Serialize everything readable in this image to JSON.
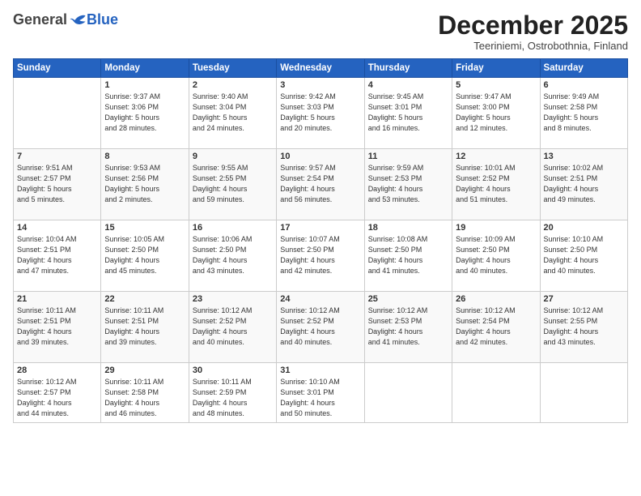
{
  "header": {
    "logo_general": "General",
    "logo_blue": "Blue",
    "month_title": "December 2025",
    "location": "Teeriniemi, Ostrobothnia, Finland"
  },
  "weekdays": [
    "Sunday",
    "Monday",
    "Tuesday",
    "Wednesday",
    "Thursday",
    "Friday",
    "Saturday"
  ],
  "weeks": [
    [
      {
        "day": "",
        "info": ""
      },
      {
        "day": "1",
        "info": "Sunrise: 9:37 AM\nSunset: 3:06 PM\nDaylight: 5 hours\nand 28 minutes."
      },
      {
        "day": "2",
        "info": "Sunrise: 9:40 AM\nSunset: 3:04 PM\nDaylight: 5 hours\nand 24 minutes."
      },
      {
        "day": "3",
        "info": "Sunrise: 9:42 AM\nSunset: 3:03 PM\nDaylight: 5 hours\nand 20 minutes."
      },
      {
        "day": "4",
        "info": "Sunrise: 9:45 AM\nSunset: 3:01 PM\nDaylight: 5 hours\nand 16 minutes."
      },
      {
        "day": "5",
        "info": "Sunrise: 9:47 AM\nSunset: 3:00 PM\nDaylight: 5 hours\nand 12 minutes."
      },
      {
        "day": "6",
        "info": "Sunrise: 9:49 AM\nSunset: 2:58 PM\nDaylight: 5 hours\nand 8 minutes."
      }
    ],
    [
      {
        "day": "7",
        "info": "Sunrise: 9:51 AM\nSunset: 2:57 PM\nDaylight: 5 hours\nand 5 minutes."
      },
      {
        "day": "8",
        "info": "Sunrise: 9:53 AM\nSunset: 2:56 PM\nDaylight: 5 hours\nand 2 minutes."
      },
      {
        "day": "9",
        "info": "Sunrise: 9:55 AM\nSunset: 2:55 PM\nDaylight: 4 hours\nand 59 minutes."
      },
      {
        "day": "10",
        "info": "Sunrise: 9:57 AM\nSunset: 2:54 PM\nDaylight: 4 hours\nand 56 minutes."
      },
      {
        "day": "11",
        "info": "Sunrise: 9:59 AM\nSunset: 2:53 PM\nDaylight: 4 hours\nand 53 minutes."
      },
      {
        "day": "12",
        "info": "Sunrise: 10:01 AM\nSunset: 2:52 PM\nDaylight: 4 hours\nand 51 minutes."
      },
      {
        "day": "13",
        "info": "Sunrise: 10:02 AM\nSunset: 2:51 PM\nDaylight: 4 hours\nand 49 minutes."
      }
    ],
    [
      {
        "day": "14",
        "info": "Sunrise: 10:04 AM\nSunset: 2:51 PM\nDaylight: 4 hours\nand 47 minutes."
      },
      {
        "day": "15",
        "info": "Sunrise: 10:05 AM\nSunset: 2:50 PM\nDaylight: 4 hours\nand 45 minutes."
      },
      {
        "day": "16",
        "info": "Sunrise: 10:06 AM\nSunset: 2:50 PM\nDaylight: 4 hours\nand 43 minutes."
      },
      {
        "day": "17",
        "info": "Sunrise: 10:07 AM\nSunset: 2:50 PM\nDaylight: 4 hours\nand 42 minutes."
      },
      {
        "day": "18",
        "info": "Sunrise: 10:08 AM\nSunset: 2:50 PM\nDaylight: 4 hours\nand 41 minutes."
      },
      {
        "day": "19",
        "info": "Sunrise: 10:09 AM\nSunset: 2:50 PM\nDaylight: 4 hours\nand 40 minutes."
      },
      {
        "day": "20",
        "info": "Sunrise: 10:10 AM\nSunset: 2:50 PM\nDaylight: 4 hours\nand 40 minutes."
      }
    ],
    [
      {
        "day": "21",
        "info": "Sunrise: 10:11 AM\nSunset: 2:51 PM\nDaylight: 4 hours\nand 39 minutes."
      },
      {
        "day": "22",
        "info": "Sunrise: 10:11 AM\nSunset: 2:51 PM\nDaylight: 4 hours\nand 39 minutes."
      },
      {
        "day": "23",
        "info": "Sunrise: 10:12 AM\nSunset: 2:52 PM\nDaylight: 4 hours\nand 40 minutes."
      },
      {
        "day": "24",
        "info": "Sunrise: 10:12 AM\nSunset: 2:52 PM\nDaylight: 4 hours\nand 40 minutes."
      },
      {
        "day": "25",
        "info": "Sunrise: 10:12 AM\nSunset: 2:53 PM\nDaylight: 4 hours\nand 41 minutes."
      },
      {
        "day": "26",
        "info": "Sunrise: 10:12 AM\nSunset: 2:54 PM\nDaylight: 4 hours\nand 42 minutes."
      },
      {
        "day": "27",
        "info": "Sunrise: 10:12 AM\nSunset: 2:55 PM\nDaylight: 4 hours\nand 43 minutes."
      }
    ],
    [
      {
        "day": "28",
        "info": "Sunrise: 10:12 AM\nSunset: 2:57 PM\nDaylight: 4 hours\nand 44 minutes."
      },
      {
        "day": "29",
        "info": "Sunrise: 10:11 AM\nSunset: 2:58 PM\nDaylight: 4 hours\nand 46 minutes."
      },
      {
        "day": "30",
        "info": "Sunrise: 10:11 AM\nSunset: 2:59 PM\nDaylight: 4 hours\nand 48 minutes."
      },
      {
        "day": "31",
        "info": "Sunrise: 10:10 AM\nSunset: 3:01 PM\nDaylight: 4 hours\nand 50 minutes."
      },
      {
        "day": "",
        "info": ""
      },
      {
        "day": "",
        "info": ""
      },
      {
        "day": "",
        "info": ""
      }
    ]
  ]
}
